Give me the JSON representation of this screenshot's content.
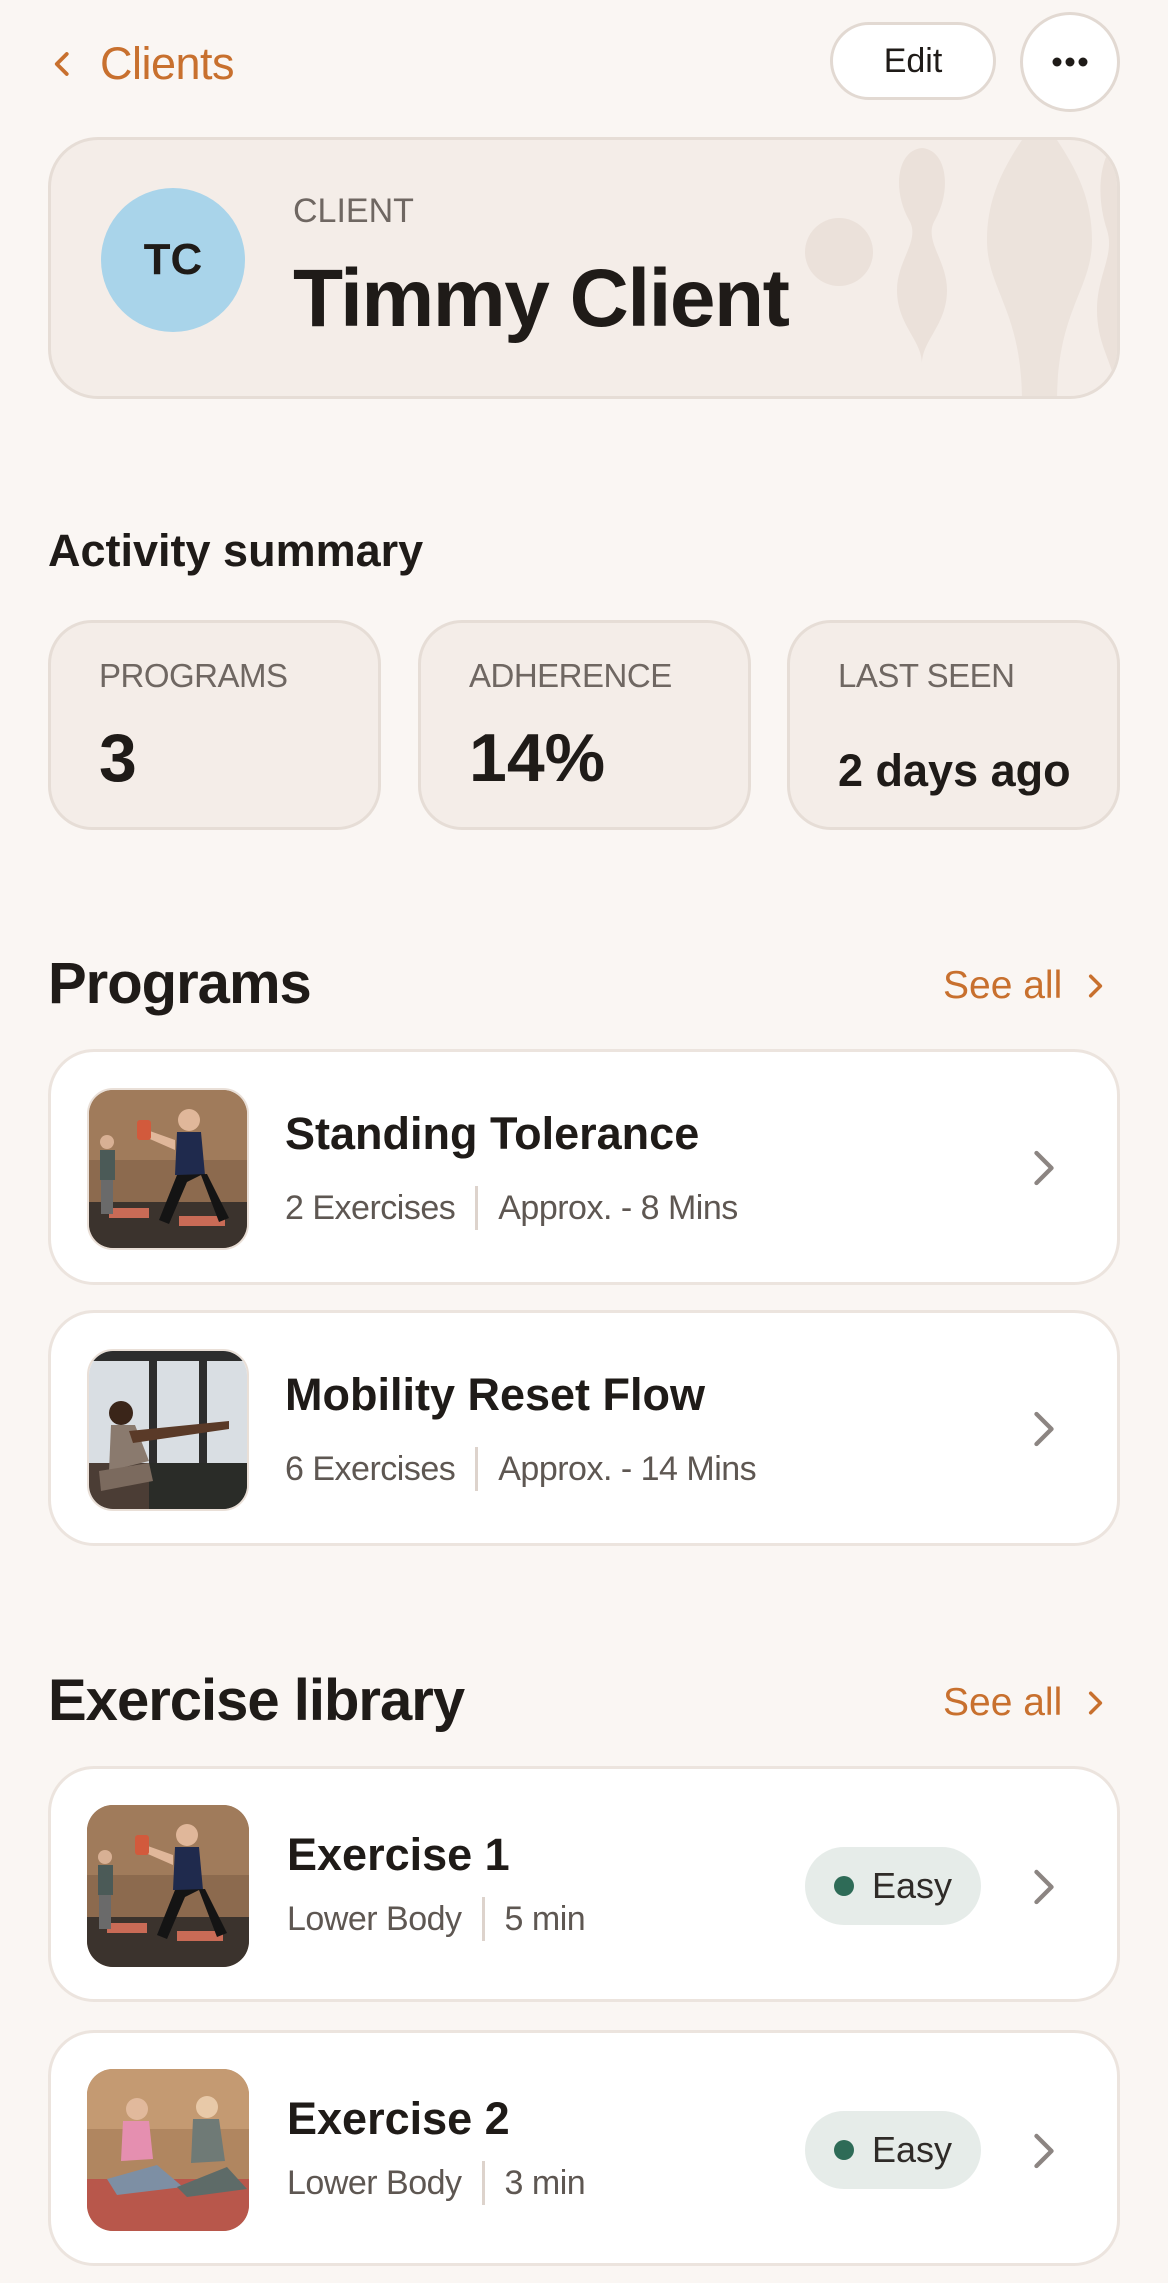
{
  "header": {
    "back_label": "Clients",
    "edit_label": "Edit"
  },
  "client": {
    "initials": "TC",
    "kicker": "CLIENT",
    "name": "Timmy Client",
    "avatar_color": "#a9d4ea"
  },
  "activity": {
    "title": "Activity summary",
    "stats": [
      {
        "label": "PROGRAMS",
        "value": "3"
      },
      {
        "label": "ADHERENCE",
        "value": "14%"
      },
      {
        "label": "LAST SEEN",
        "value": "2 days ago"
      }
    ]
  },
  "programs": {
    "title": "Programs",
    "see_all": "See all",
    "items": [
      {
        "title": "Standing Tolerance",
        "exercises": "2 Exercises",
        "duration": "Approx. - 8 Mins"
      },
      {
        "title": "Mobility Reset Flow",
        "exercises": "6 Exercises",
        "duration": "Approx. - 14 Mins"
      }
    ]
  },
  "library": {
    "title": "Exercise library",
    "see_all": "See all",
    "items": [
      {
        "title": "Exercise 1",
        "category": "Lower Body",
        "duration": "5 min",
        "difficulty": "Easy"
      },
      {
        "title": "Exercise 2",
        "category": "Lower Body",
        "duration": "3 min",
        "difficulty": "Easy"
      }
    ]
  },
  "colors": {
    "accent": "#c8702e",
    "background": "#faf6f3",
    "card_tint": "#f4ede8",
    "easy_dot": "#2e6b57"
  }
}
